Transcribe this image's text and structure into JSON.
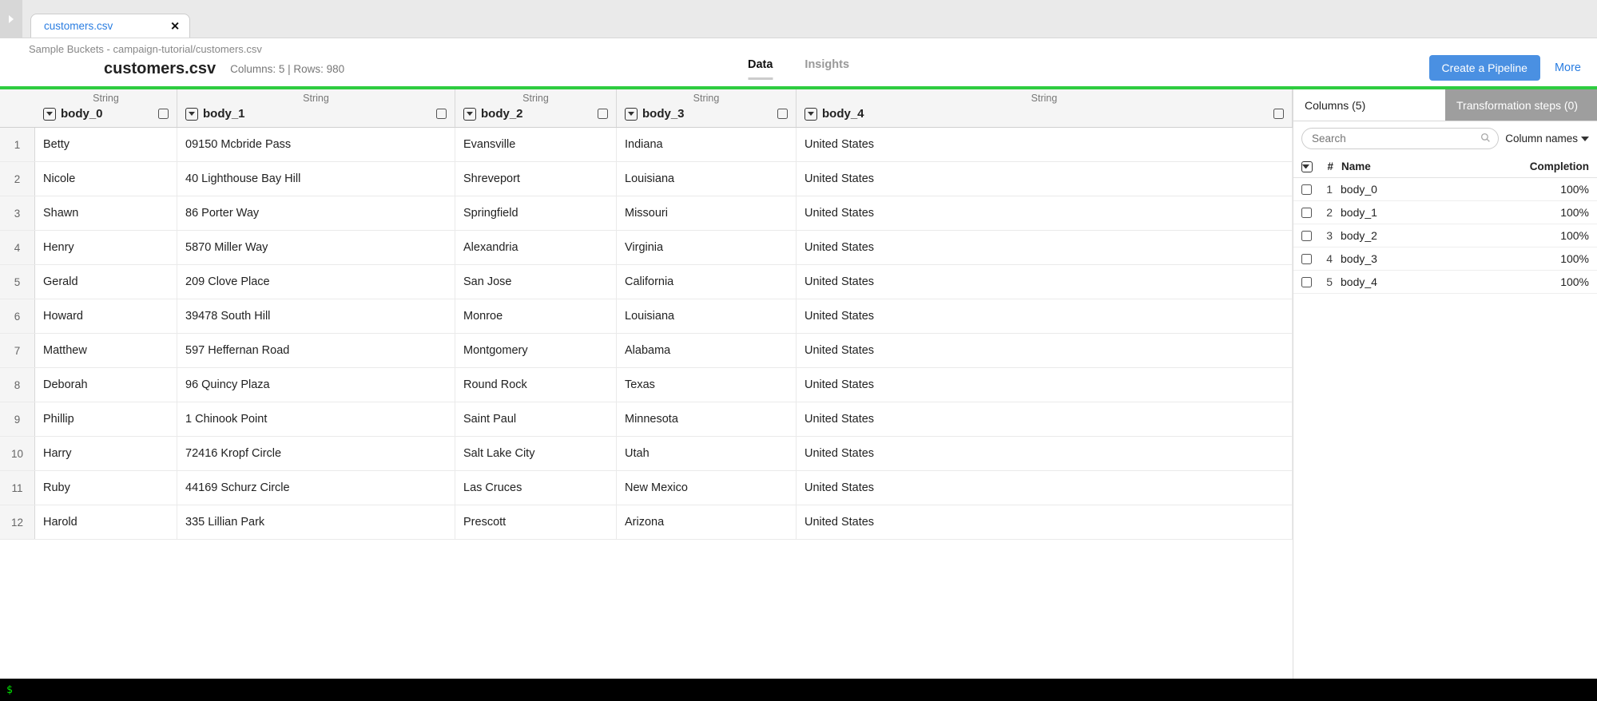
{
  "tab": {
    "filename": "customers.csv"
  },
  "breadcrumb": "Sample Buckets - campaign-tutorial/customers.csv",
  "file_title": "customers.csv",
  "meta": "Columns: 5 | Rows: 980",
  "center_tabs": {
    "data": "Data",
    "insights": "Insights"
  },
  "actions": {
    "create_pipeline": "Create a Pipeline",
    "more": "More"
  },
  "grid": {
    "columns": [
      {
        "type": "String",
        "name": "body_0"
      },
      {
        "type": "String",
        "name": "body_1"
      },
      {
        "type": "String",
        "name": "body_2"
      },
      {
        "type": "String",
        "name": "body_3"
      },
      {
        "type": "String",
        "name": "body_4"
      }
    ],
    "rows": [
      [
        "Betty",
        "09150 Mcbride Pass",
        "Evansville",
        "Indiana",
        "United States"
      ],
      [
        "Nicole",
        "40 Lighthouse Bay Hill",
        "Shreveport",
        "Louisiana",
        "United States"
      ],
      [
        "Shawn",
        "86 Porter Way",
        "Springfield",
        "Missouri",
        "United States"
      ],
      [
        "Henry",
        "5870 Miller Way",
        "Alexandria",
        "Virginia",
        "United States"
      ],
      [
        "Gerald",
        "209 Clove Place",
        "San Jose",
        "California",
        "United States"
      ],
      [
        "Howard",
        "39478 South Hill",
        "Monroe",
        "Louisiana",
        "United States"
      ],
      [
        "Matthew",
        "597 Heffernan Road",
        "Montgomery",
        "Alabama",
        "United States"
      ],
      [
        "Deborah",
        "96 Quincy Plaza",
        "Round Rock",
        "Texas",
        "United States"
      ],
      [
        "Phillip",
        "1 Chinook Point",
        "Saint Paul",
        "Minnesota",
        "United States"
      ],
      [
        "Harry",
        "72416 Kropf Circle",
        "Salt Lake City",
        "Utah",
        "United States"
      ],
      [
        "Ruby",
        "44169 Schurz Circle",
        "Las Cruces",
        "New Mexico",
        "United States"
      ],
      [
        "Harold",
        "335 Lillian Park",
        "Prescott",
        "Arizona",
        "United States"
      ]
    ]
  },
  "side": {
    "tabs": {
      "columns": "Columns (5)",
      "transform": "Transformation steps (0)"
    },
    "search_placeholder": "Search",
    "scope": "Column names",
    "head": {
      "num": "#",
      "name": "Name",
      "completion": "Completion"
    },
    "rows": [
      {
        "num": "1",
        "name": "body_0",
        "completion": "100%"
      },
      {
        "num": "2",
        "name": "body_1",
        "completion": "100%"
      },
      {
        "num": "3",
        "name": "body_2",
        "completion": "100%"
      },
      {
        "num": "4",
        "name": "body_3",
        "completion": "100%"
      },
      {
        "num": "5",
        "name": "body_4",
        "completion": "100%"
      }
    ]
  },
  "terminal_prompt": "$"
}
